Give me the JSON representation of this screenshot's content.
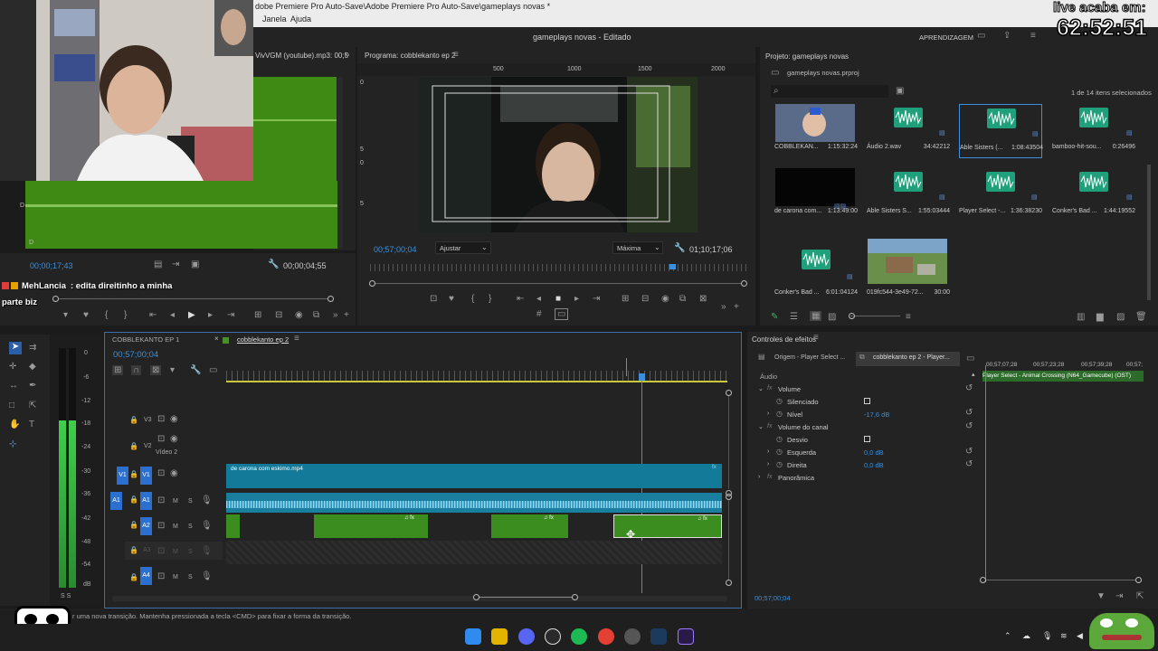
{
  "topbar": {
    "title": "dobe Premiere Pro Auto-Save\\Adobe Premiere Pro Auto-Save\\gameplays novas *"
  },
  "menubar": {
    "items": [
      "Janela",
      "Ajuda"
    ]
  },
  "app": {
    "title": "gameplays novas - Editado",
    "workspace": "APRENDIZAGEM"
  },
  "overlay": {
    "timer_label": "live acaba em:",
    "timer_value": "62:52:51"
  },
  "chat": {
    "user": "MehLancia",
    "message_line1": ": edita direitinho a minha",
    "message_line2": "parte biz"
  },
  "source": {
    "title": "VivVGM (youtube).mp3: 00;5",
    "timecode_in": "00;00;17;43",
    "timecode_dur": "00;00;04;55",
    "db_top": "D",
    "db_bottom": "D"
  },
  "program": {
    "title": "Programa: cobblekanto ep 2",
    "timecode": "00;57;00;04",
    "fit": "Ajustar",
    "quality": "Máxima",
    "duration": "01;10;17;06",
    "ruler": [
      "500",
      "1000",
      "1500",
      "2000"
    ],
    "side_ruler": [
      "0",
      "5",
      "0",
      "5"
    ]
  },
  "project": {
    "title": "Projeto: gameplays novas",
    "file": "gameplays novas.prproj",
    "selected": "1 de 14 itens selecionados",
    "items": [
      {
        "name": "COBBLEKAN...",
        "dur": "1:15:32:24",
        "kind": "video"
      },
      {
        "name": "Áudio 2.wav",
        "dur": "34:42212",
        "kind": "audio"
      },
      {
        "name": "Able Sisters (...",
        "dur": "1:08:43504",
        "kind": "audio"
      },
      {
        "name": "bamboo-hit-sou...",
        "dur": "0:26496",
        "kind": "audio"
      },
      {
        "name": "de carona com...",
        "dur": "1:13:49:00",
        "kind": "black"
      },
      {
        "name": "Able Sisters S...",
        "dur": "1:55:03444",
        "kind": "audio"
      },
      {
        "name": "Player Select -...",
        "dur": "1:36:38230",
        "kind": "audio"
      },
      {
        "name": "Conker's Bad ...",
        "dur": "1:44:19552",
        "kind": "audio"
      },
      {
        "name": "Conker's Bad ...",
        "dur": "6:01:04124",
        "kind": "audio"
      },
      {
        "name": "019fc544-3e49-72...",
        "dur": "30:00",
        "kind": "game"
      }
    ]
  },
  "timeline": {
    "tabs": [
      "COBBLEKANTO EP 1",
      "cobblekanto ep 2"
    ],
    "timecode": "00;57;00;04",
    "video_tracks": [
      "V3",
      "V2",
      "V1"
    ],
    "v2_name": "Vídeo 2",
    "audio_tracks": [
      "A1",
      "A2",
      "A3",
      "A4"
    ],
    "source_v": "V1",
    "source_a": "A1",
    "clip_video": "de carona com eskimo.mp4",
    "meter_labels": [
      "0",
      "-6",
      "-12",
      "-18",
      "-24",
      "-30",
      "-36",
      "-42",
      "-48",
      "-54",
      "dB"
    ],
    "meter_ss": "S  S"
  },
  "effects": {
    "title": "Controles de efeitos",
    "tab_source": "Origem - Player Select ...",
    "tab_seq": "cobblekanto ep 2 - Player...",
    "ruler": [
      "00;57;07;28",
      "00;57;23;28",
      "00;57;39;28",
      "00;57;"
    ],
    "clip_label": "Player Select - Animal Crossing (N64_Gamecube) (OST)",
    "section": "Áudio",
    "volume": "Volume",
    "silenced": "Silenciado",
    "level": "Nível",
    "level_val": "-17,6 dB",
    "channel_volume": "Volume do canal",
    "bypass": "Desvio",
    "left": "Esquerda",
    "left_val": "0,0 dB",
    "right": "Direita",
    "right_val": "0,0 dB",
    "pan": "Panorâmica",
    "timecode": "00;57;00;04"
  },
  "status": {
    "text": "r uma nova transição. Mantenha pressionada a tecla <CMD> para fixar a forma da transição."
  },
  "colors": {
    "accent": "#3b8fdc",
    "clip_video": "#137a9a",
    "clip_audio": "#2d8a1d",
    "audio_green": "#4c8f1b"
  }
}
